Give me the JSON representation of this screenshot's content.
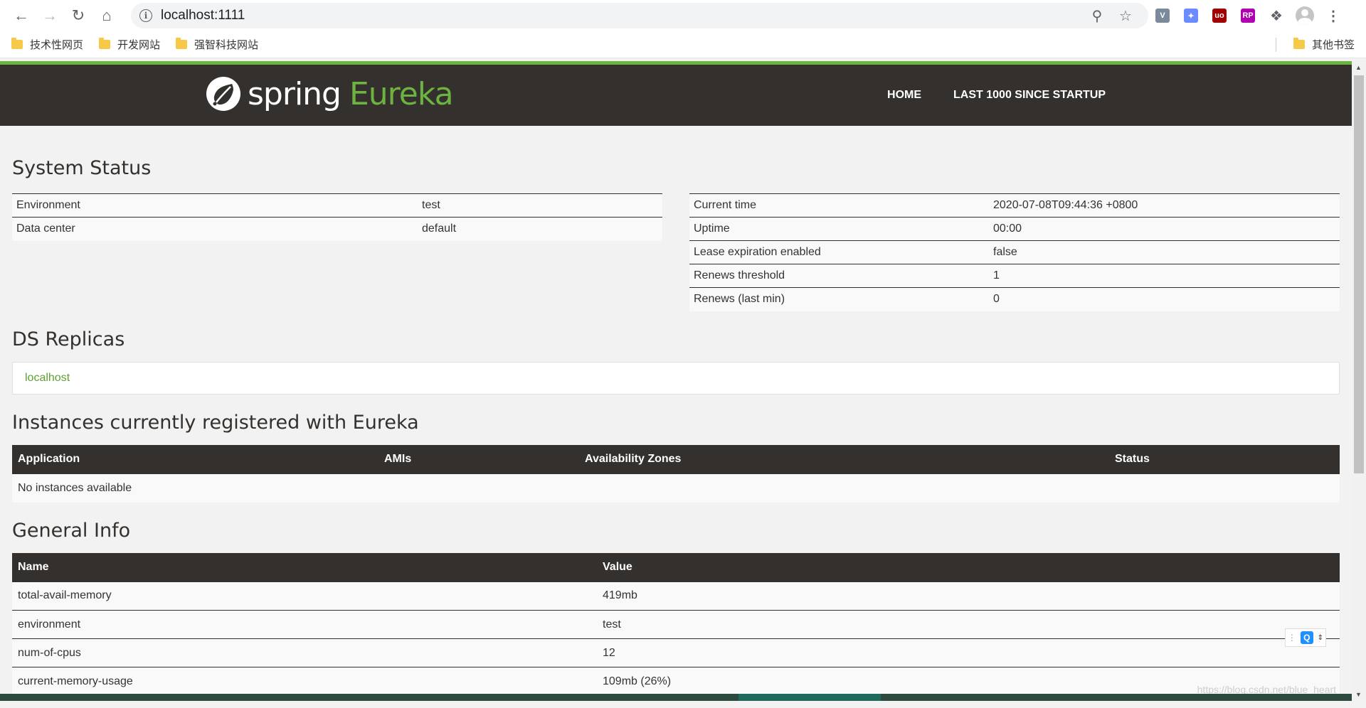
{
  "browser": {
    "url": "localhost:1111",
    "bookmarks": [
      "技术性网页",
      "开发网站",
      "强智科技网站"
    ],
    "other_bookmarks": "其他书签",
    "extensions": [
      {
        "name": "vue-icon",
        "color": "#7a8a9a",
        "label": "V"
      },
      {
        "name": "bird-icon",
        "color": "#6a8cff",
        "label": "✦"
      },
      {
        "name": "ublock-icon",
        "color": "#a00000",
        "label": "uo"
      },
      {
        "name": "rp-icon",
        "color": "#b000b0",
        "label": "RP"
      }
    ]
  },
  "header": {
    "logo_spring": "spring",
    "logo_eureka": "Eureka",
    "nav": [
      "HOME",
      "LAST 1000 SINCE STARTUP"
    ]
  },
  "system_status": {
    "title": "System Status",
    "left": [
      {
        "key": "Environment",
        "value": "test"
      },
      {
        "key": "Data center",
        "value": "default"
      }
    ],
    "right": [
      {
        "key": "Current time",
        "value": "2020-07-08T09:44:36 +0800"
      },
      {
        "key": "Uptime",
        "value": "00:00"
      },
      {
        "key": "Lease expiration enabled",
        "value": "false"
      },
      {
        "key": "Renews threshold",
        "value": "1"
      },
      {
        "key": "Renews (last min)",
        "value": "0"
      }
    ]
  },
  "ds_replicas": {
    "title": "DS Replicas",
    "items": [
      "localhost"
    ]
  },
  "instances": {
    "title": "Instances currently registered with Eureka",
    "columns": [
      "Application",
      "AMIs",
      "Availability Zones",
      "Status"
    ],
    "empty": "No instances available"
  },
  "general_info": {
    "title": "General Info",
    "columns": [
      "Name",
      "Value"
    ],
    "rows": [
      {
        "name": "total-avail-memory",
        "value": "419mb"
      },
      {
        "name": "environment",
        "value": "test"
      },
      {
        "name": "num-of-cpus",
        "value": "12"
      },
      {
        "name": "current-memory-usage",
        "value": "109mb (26%)"
      }
    ]
  },
  "watermark": "https://blog.csdn.net/blue_heart"
}
